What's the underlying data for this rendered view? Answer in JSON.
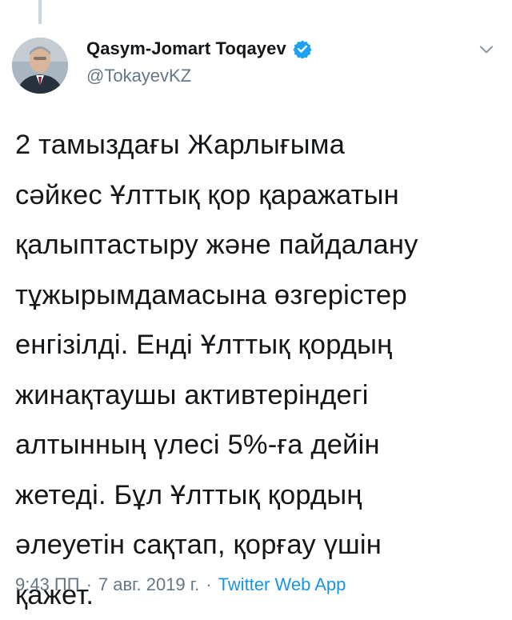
{
  "author": {
    "display_name": "Qasym-Jomart Toqayev",
    "handle": "@TokayevKZ",
    "verified_icon": "verified-badge-icon",
    "avatar_icon": "profile-photo"
  },
  "tweet": {
    "text": "2 тамыздағы Жарлығыма\nсәйкес Ұлттық қор қаражатын\nқалыптастыру және пайдалану\nтұжырымдамасына өзгерістер\nенгізілді. Енді Ұлттық қордың\nжинақтаушы активтеріндегі\nалтынның үлесі 5%-ға дейін\nжетеді. Бұл Ұлттық қордың\nәлеуетін сақтап, қорғау үшін\nқажет."
  },
  "meta": {
    "time": "9:43 ПП",
    "separator": "·",
    "date": "7 авг. 2019 г.",
    "source": "Twitter Web App"
  },
  "menu": {
    "icon": "chevron-down-icon"
  },
  "colors": {
    "text": "#14171a",
    "secondary": "#657786",
    "link": "#1b95e0",
    "verified": "#1da1f2",
    "thread_line": "#ccd6dd"
  }
}
